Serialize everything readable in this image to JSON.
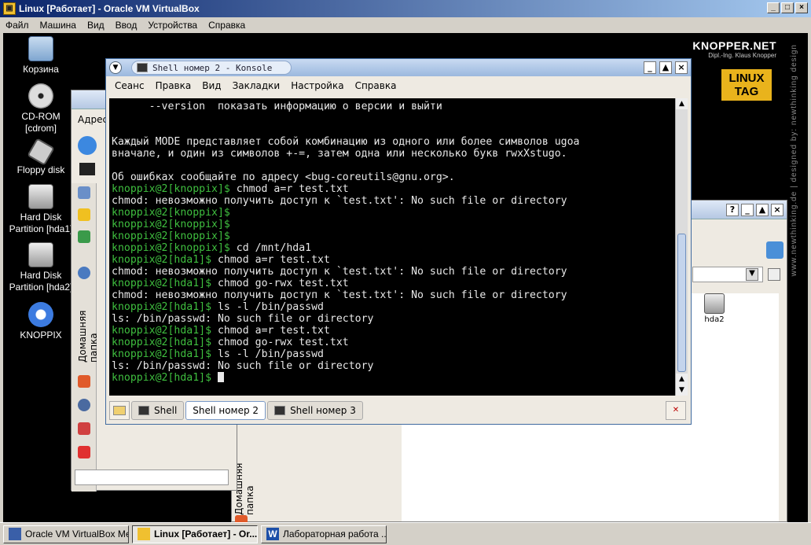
{
  "host": {
    "title": "Linux [Работает] - Oracle VM VirtualBox",
    "menu": [
      "Файл",
      "Машина",
      "Вид",
      "Ввод",
      "Устройства",
      "Справка"
    ],
    "controls": [
      "_",
      "□",
      "×"
    ]
  },
  "desktop": {
    "logo": {
      "brand": "KNOPPER.NET",
      "sub": "Dipl.-Ing. Klaus Knopper",
      "tag_line1": "LINUX",
      "tag_line2": "TAG",
      "vertical": "www.newthinking.de  |  designed by: newthinking design"
    },
    "icons": [
      {
        "label": "Корзина",
        "icon": "trash-icon"
      },
      {
        "label": "CD-ROM [cdrom]",
        "icon": "cdrom-icon"
      },
      {
        "label": "Floppy disk",
        "icon": "floppy-icon"
      },
      {
        "label": "Hard Disk Partition [hda1]",
        "icon": "harddisk-icon"
      },
      {
        "label": "Hard Disk Partition [hda2]",
        "icon": "harddisk-icon"
      },
      {
        "label": "KNOPPIX",
        "icon": "knoppix-icon"
      }
    ]
  },
  "konqueror": {
    "address_label": "Адрес",
    "sidebar_tab": "Домашняя папка",
    "hda2_label": "hda2"
  },
  "konsole": {
    "title": "Shell номер 2 - Konsole",
    "menu": [
      "Сеанс",
      "Правка",
      "Вид",
      "Закладки",
      "Настройка",
      "Справка"
    ],
    "lines": [
      {
        "t": "      --version  показать информацию о версии и выйти",
        "c": "default"
      },
      {
        "t": "",
        "c": "default"
      },
      {
        "t": "",
        "c": "default"
      },
      {
        "t": "Каждый MODE представляет собой комбинацию из одного или более символов ugoa",
        "c": "default"
      },
      {
        "t": "вначале, и один из символов +-=, затем одна или несколько букв rwxXstugo.",
        "c": "default"
      },
      {
        "t": "",
        "c": "default"
      },
      {
        "t": "Об ошибках сообщайте по адресу <bug-coreutils@gnu.org>.",
        "c": "default"
      },
      {
        "p": "knoppix@2[knoppix]$",
        "t": " chmod a=r test.txt"
      },
      {
        "t": "chmod: невозможно получить доступ к `test.txt': No such file or directory",
        "c": "default"
      },
      {
        "p": "knoppix@2[knoppix]$",
        "t": ""
      },
      {
        "p": "knoppix@2[knoppix]$",
        "t": ""
      },
      {
        "p": "knoppix@2[knoppix]$",
        "t": ""
      },
      {
        "p": "knoppix@2[knoppix]$",
        "t": " cd /mnt/hda1"
      },
      {
        "p": "knoppix@2[hda1]$",
        "t": " chmod a=r test.txt"
      },
      {
        "t": "chmod: невозможно получить доступ к `test.txt': No such file or directory",
        "c": "default"
      },
      {
        "p": "knoppix@2[hda1]$",
        "t": " chmod go-rwx test.txt"
      },
      {
        "t": "chmod: невозможно получить доступ к `test.txt': No such file or directory",
        "c": "default"
      },
      {
        "p": "knoppix@2[hda1]$",
        "t": " ls -l /bin/passwd"
      },
      {
        "t": "ls: /bin/passwd: No such file or directory",
        "c": "default"
      },
      {
        "p": "knoppix@2[hda1]$",
        "t": " chmod a=r test.txt"
      },
      {
        "p": "knoppix@2[hda1]$",
        "t": " chmod go-rwx test.txt"
      },
      {
        "p": "knoppix@2[hda1]$",
        "t": " ls -l /bin/passwd"
      },
      {
        "t": "ls: /bin/passwd: No such file or directory",
        "c": "default"
      },
      {
        "p": "knoppix@2[hda1]$",
        "t": " ",
        "cursor": true
      }
    ],
    "tabs": [
      {
        "label": "Shell",
        "active": false
      },
      {
        "label": "Shell номер 2",
        "active": true
      },
      {
        "label": "Shell номер 3",
        "active": false
      }
    ]
  },
  "taskbar": {
    "items": [
      {
        "label": "Oracle VM VirtualBox Ме...",
        "active": false,
        "color": "#3a5fa8"
      },
      {
        "label": "Linux [Работает] - Or...",
        "active": true,
        "color": "#f0c030"
      },
      {
        "label": "Лабораторная работа ...",
        "active": false,
        "color": "#1d4fa8"
      }
    ]
  },
  "colors": {
    "terminal_bg": "#000000",
    "prompt": "#3fbf3f",
    "text": "#e8e8e8",
    "host_title": "#0a246a"
  }
}
